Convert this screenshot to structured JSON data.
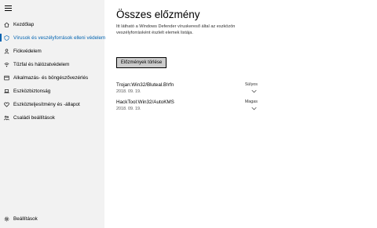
{
  "sidebar": {
    "items": [
      {
        "label": "Kezdőlap",
        "icon": "home-icon"
      },
      {
        "label": "Vírusok és veszélyforrások elleni védelem",
        "icon": "shield-icon"
      },
      {
        "label": "Fiókvédelem",
        "icon": "person-icon"
      },
      {
        "label": "Tűzfal és hálózatvédelem",
        "icon": "wifi-icon"
      },
      {
        "label": "Alkalmazás- és böngészővezérlés",
        "icon": "app-window-icon"
      },
      {
        "label": "Eszközbiztonság",
        "icon": "laptop-icon"
      },
      {
        "label": "Eszközteljesítmény és -állapot",
        "icon": "heart-icon"
      },
      {
        "label": "Családi beállítások",
        "icon": "family-icon"
      }
    ],
    "active_index": 1,
    "settings_label": "Beállítások",
    "accent": "#0063b1"
  },
  "main": {
    "title": "Összes előzmény",
    "description": "Itt látható a Windows Defender víruskereső által az eszközön veszélyforrásként észlelt elemek listája.",
    "clear_button": "Előzmények törlése",
    "threats": [
      {
        "name": "Trojan:Win32/Bluteal.B!rfn",
        "date": "2018. 09. 19.",
        "severity": "Súlyos"
      },
      {
        "name": "HackTool:Win32/AutoKMS",
        "date": "2018. 09. 19.",
        "severity": "Magas"
      }
    ]
  }
}
